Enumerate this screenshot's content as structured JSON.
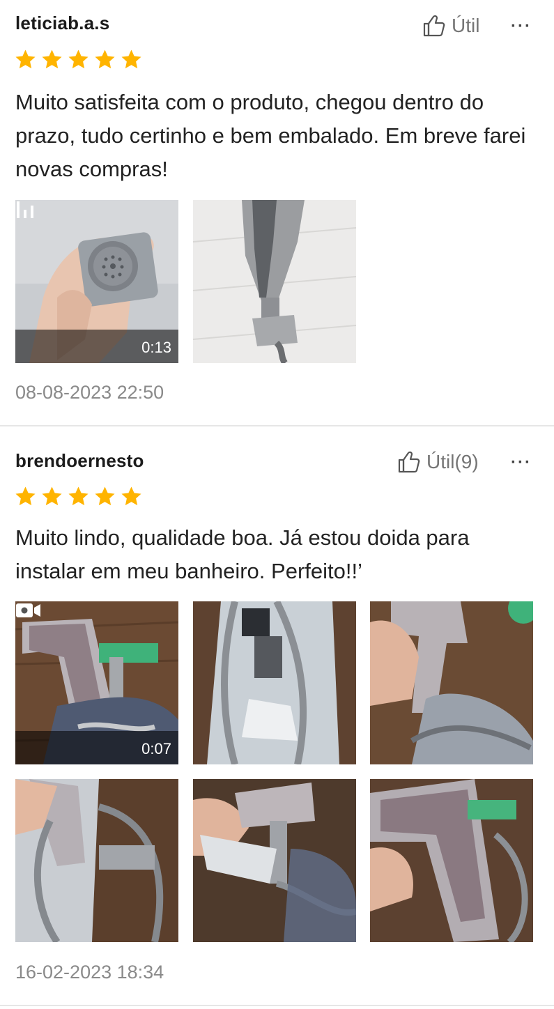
{
  "reviews": [
    {
      "username": "leticiab.a.s",
      "helpful_label": "Útil",
      "more_label": "···",
      "rating": 5,
      "comment": "Muito satisfeita com o produto, chegou dentro do prazo, tudo certinho e bem embalado. Em breve farei novas compras!",
      "media": [
        {
          "kind": "video",
          "duration": "0:13",
          "icon": "audio-bars-icon",
          "subject": "hand-holding-shower-head"
        },
        {
          "kind": "photo",
          "subject": "installed-shower-on-tile-wall"
        }
      ],
      "timestamp": "08-08-2023 22:50"
    },
    {
      "username": "brendoernesto",
      "helpful_label": "Útil(9)",
      "more_label": "···",
      "rating": 5,
      "comment": "Muito lindo, qualidade boa. Já estou doida para instalar em meu banheiro. Perfeito!!’",
      "media": [
        {
          "kind": "video",
          "duration": "0:07",
          "icon": "video-camera-icon",
          "subject": "chrome-shower-on-wood"
        },
        {
          "kind": "photo",
          "subject": "shower-hose-in-plastic-bag"
        },
        {
          "kind": "photo",
          "subject": "hand-holding-chrome-shower"
        },
        {
          "kind": "photo",
          "subject": "shower-hose-coiled"
        },
        {
          "kind": "photo",
          "subject": "hand-holding-valve"
        },
        {
          "kind": "photo",
          "subject": "chrome-shower-closeup"
        }
      ],
      "timestamp": "16-02-2023 18:34"
    }
  ],
  "colors": {
    "star": "#FFB400",
    "text": "#222222",
    "muted": "#8a8a8a",
    "divider": "#e6e6e6"
  }
}
